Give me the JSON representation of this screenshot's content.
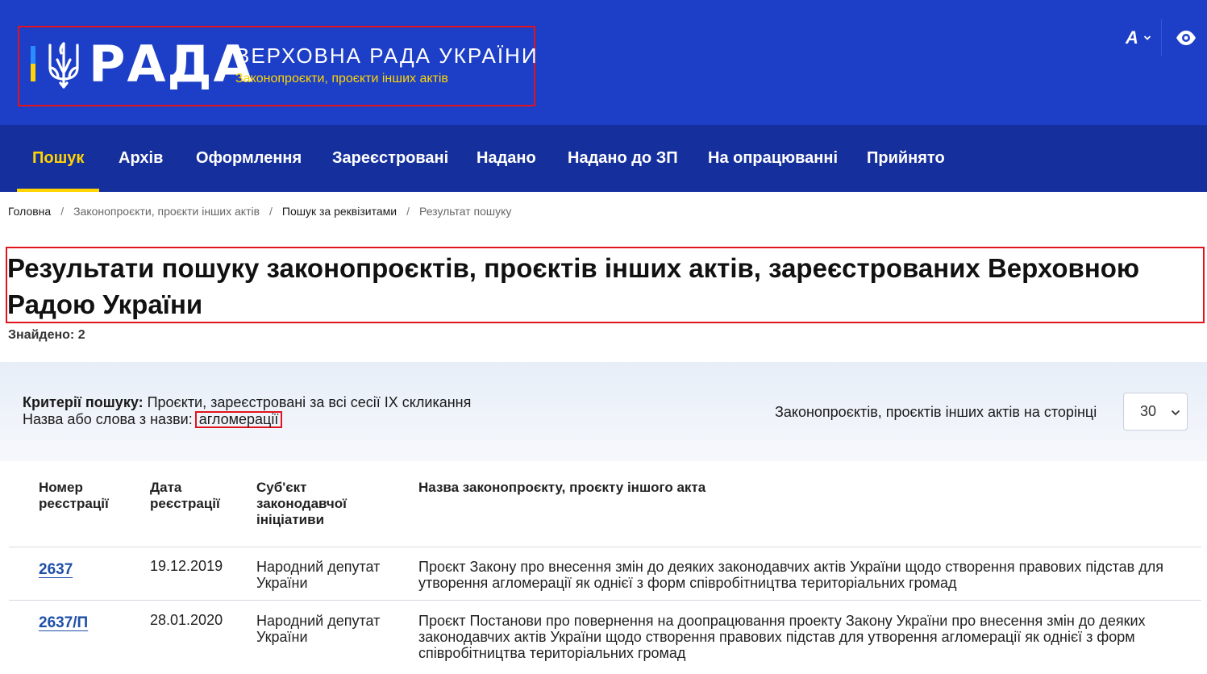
{
  "header": {
    "logo_word": "РАДА",
    "site_title": "ВЕРХОВНА РАДА УКРАЇНИ",
    "site_subtitle": "Законопроєкти, проєкти інших актів",
    "font_button_label": "A",
    "brand_blue": "#1d3fc7",
    "nav_blue": "#152f9c",
    "accent_yellow": "#ffd400",
    "icons": [
      "trident-icon",
      "chevron-down-icon",
      "eye-icon"
    ]
  },
  "nav": {
    "items": [
      {
        "label": "Пошук",
        "active": true
      },
      {
        "label": "Архів"
      },
      {
        "label": "Оформлення"
      },
      {
        "label": "Зареєстровані"
      },
      {
        "label": "Надано"
      },
      {
        "label": "Надано до ЗП"
      },
      {
        "label": "На опрацюванні"
      },
      {
        "label": "Прийнято"
      }
    ]
  },
  "breadcrumb": {
    "items": [
      "Головна",
      "Законопроєкти, проєкти інших актів",
      "Пошук за реквізитами",
      "Результат пошуку"
    ],
    "separator": "/"
  },
  "page": {
    "title": "Результати пошуку законопроєктів, проєктів інших актів, зареєстрованих Верховною Радою України",
    "found": "Знайдено: 2"
  },
  "criteria": {
    "label": "Критерії пошуку:",
    "text": " Проєкти, зареєстровані за всі сесії IX скликання",
    "name_label": "Назва або слова з назви:",
    "name_value": "агломерації",
    "per_page_label": "Законопроєктів, проєктів інших актів на сторінці",
    "per_page_value": "30"
  },
  "table": {
    "headers": [
      "Номер реєстрації",
      "Дата реєстрації",
      "Суб'єкт законодавчої ініціативи",
      "Назва законопроєкту, проєкту іншого акта"
    ],
    "rows": [
      {
        "number": "2637",
        "date": "19.12.2019",
        "subject": "Народний депутат України",
        "name": "Проєкт Закону про внесення змін до деяких законодавчих актів України щодо створення правових підстав для утворення агломерації як однієї з форм співробітництва територіальних громад"
      },
      {
        "number": "2637/П",
        "date": "28.01.2020",
        "subject": "Народний депутат України",
        "name": "Проєкт Постанови про повернення на доопрацювання проекту Закону України про внесення змін до деяких законодавчих актів України щодо створення правових підстав для утворення агломерації як однієї з форм співробітництва територіальних громад"
      }
    ]
  }
}
